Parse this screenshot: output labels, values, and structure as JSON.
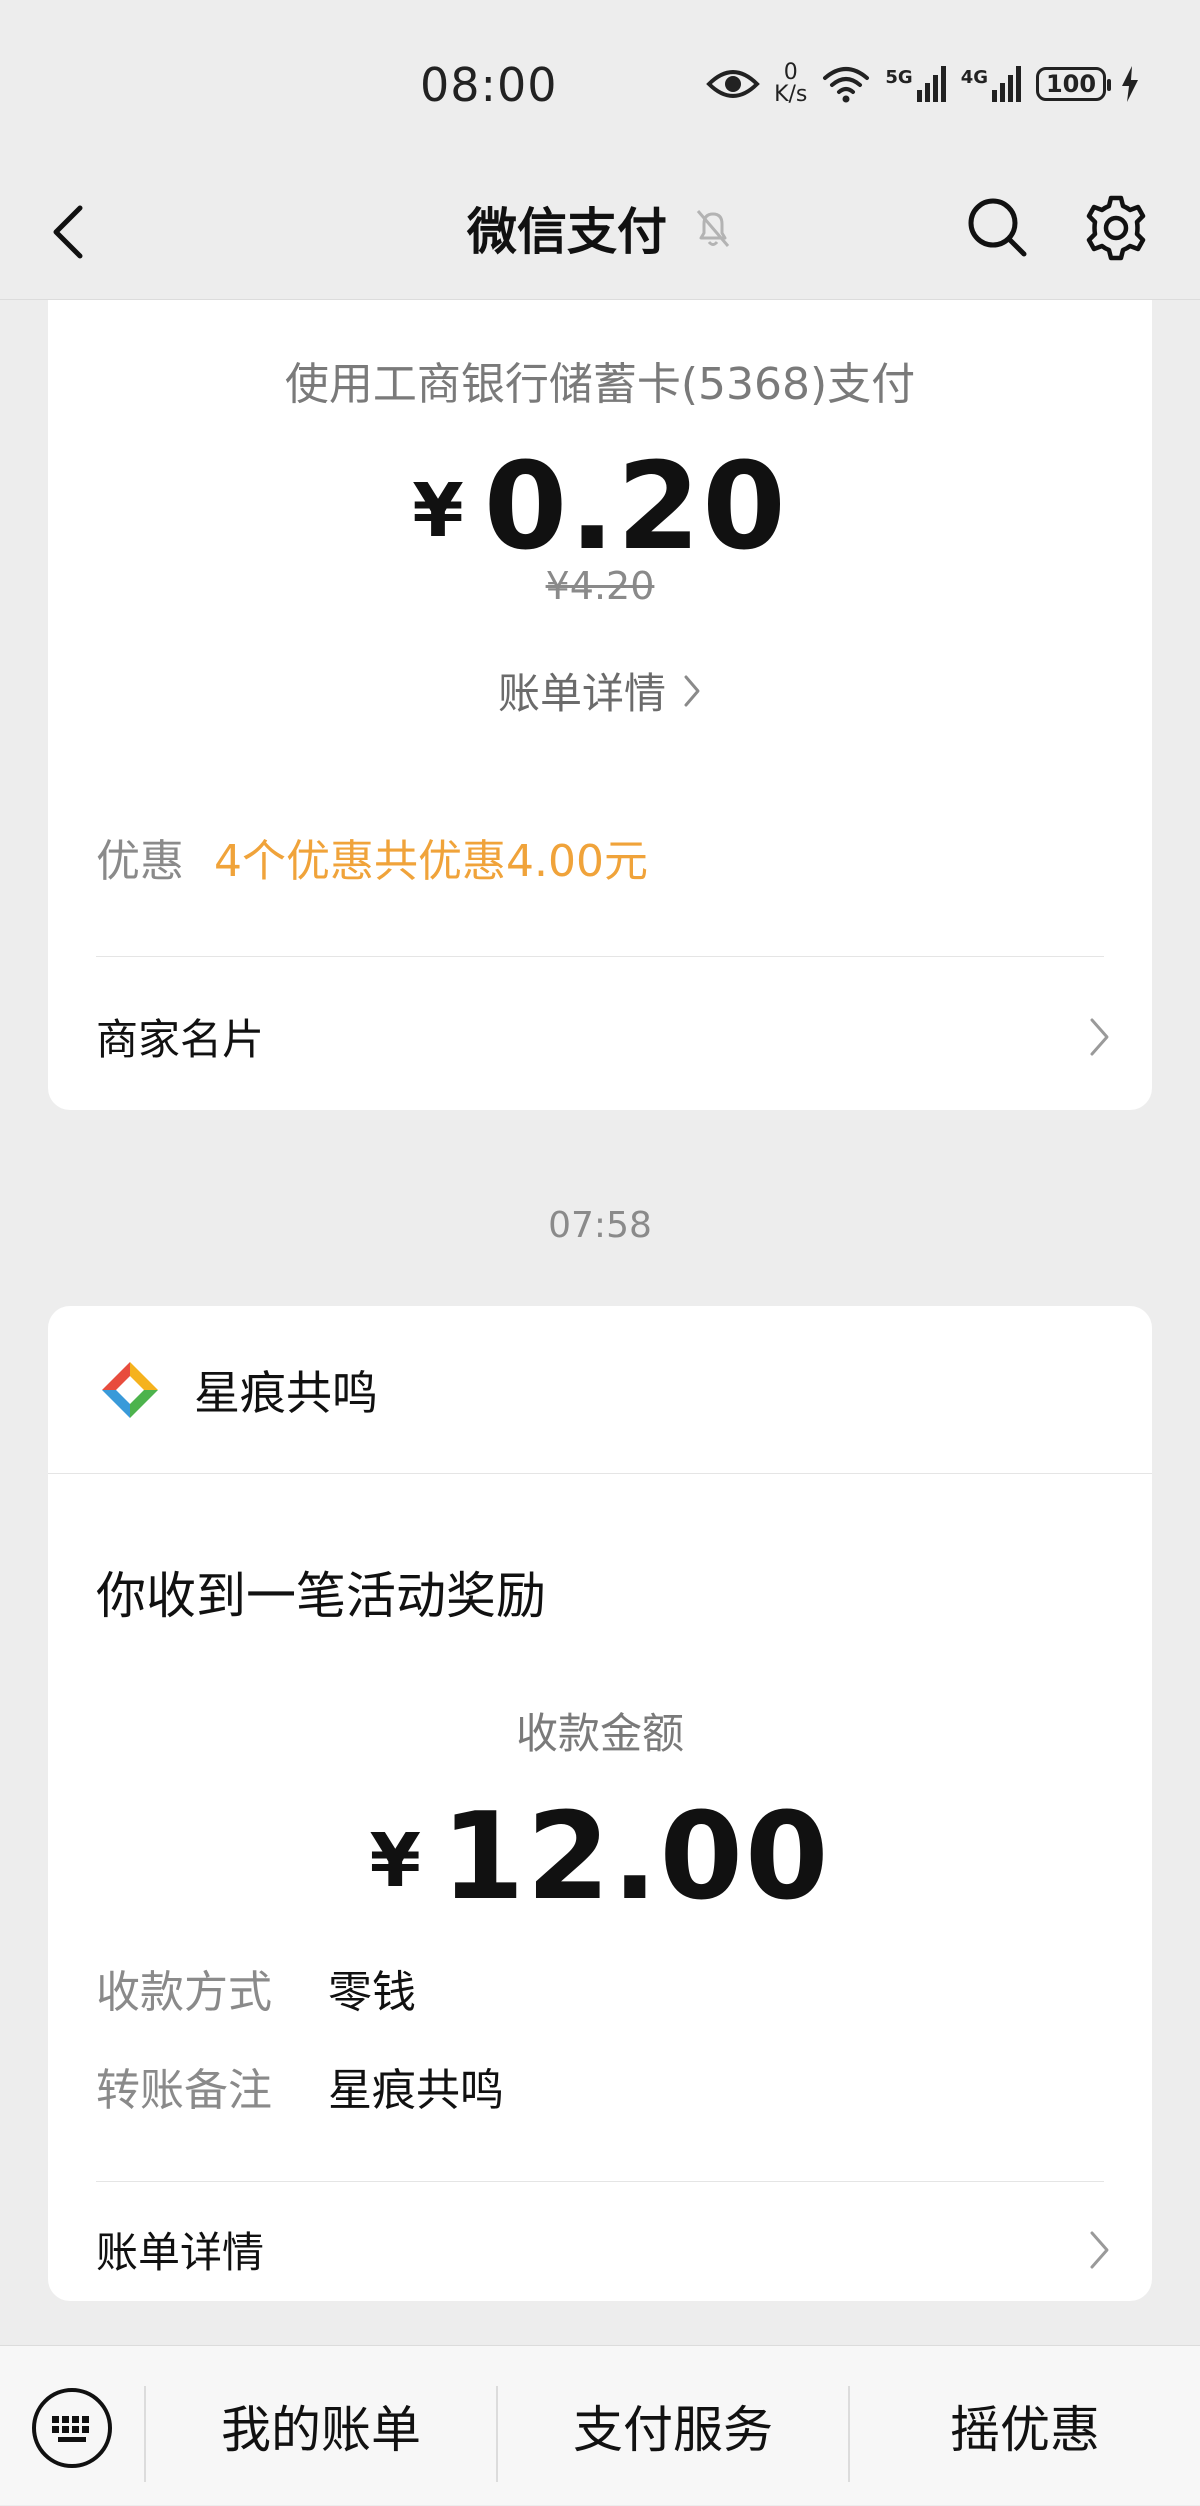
{
  "status_bar": {
    "time": "08:00",
    "net_speed_value": "0",
    "net_speed_unit": "K/s",
    "signal1_label": "5G",
    "signal2_label": "4G",
    "battery": "100"
  },
  "nav": {
    "title": "微信支付"
  },
  "payment_card": {
    "pay_method": "使用工商银行储蓄卡(5368)支付",
    "currency_symbol": "¥",
    "amount": "0.20",
    "original_amount": "¥4.20",
    "bill_detail_label": "账单详情",
    "discount_label": "优惠",
    "discount_value": "4个优惠共优惠4.00元",
    "merchant_card_label": "商家名片"
  },
  "timestamp": "07:58",
  "reward_card": {
    "merchant_name": "星痕共鸣",
    "title": "你收到一笔活动奖励",
    "amount_label": "收款金额",
    "currency_symbol": "¥",
    "amount": "12.00",
    "method_label": "收款方式",
    "method_value": "零钱",
    "note_label": "转账备注",
    "note_value": "星痕共鸣",
    "bill_detail_label": "账单详情"
  },
  "bottom_menu": {
    "items": [
      "我的账单",
      "支付服务",
      "摇优惠"
    ]
  },
  "colors": {
    "background": "#ededed",
    "card": "#ffffff",
    "discount_accent": "#f0a33a",
    "secondary_text": "#8a8a8a"
  }
}
